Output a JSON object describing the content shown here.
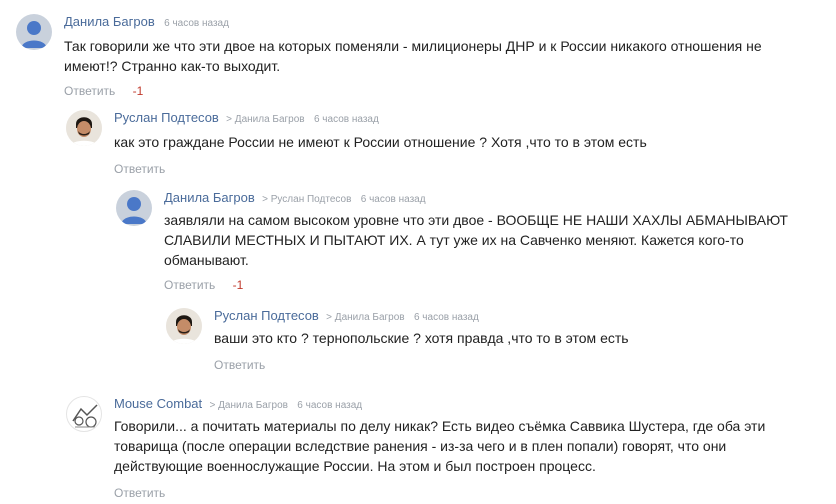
{
  "comments": [
    {
      "author": "Данила Багров",
      "reply_to": "",
      "time": "6 часов назад",
      "lines": [
        "Так говорили же что эти двое на которых поменяли - милиционеры ДНР и к России никакого отношения не",
        "имеют!? Странно как-то выходит."
      ],
      "reply_label": "Ответить",
      "vote": "-1",
      "avatar": "default-user-icon"
    },
    {
      "author": "Руслан Подтесов",
      "reply_to": "> Данила Багров",
      "time": "6 часов назад",
      "lines": [
        "как это граждане России не имеют к России отношение ? Хотя ,что то в этом есть"
      ],
      "reply_label": "Ответить",
      "vote": "",
      "avatar": "user-photo-icon"
    },
    {
      "author": "Данила Багров",
      "reply_to": "> Руслан Подтесов",
      "time": "6 часов назад",
      "lines": [
        "заявляли на самом высоком уровне что эти двое - ВООБЩЕ НЕ НАШИ ХАХЛЫ АБМАНЫВАЮТ",
        "СЛАВИЛИ МЕСТНЫХ И ПЫТАЮТ ИХ. А тут уже их на Савченко меняют. Кажется кого-то",
        "обманывают."
      ],
      "reply_label": "Ответить",
      "vote": "-1",
      "avatar": "default-user-icon"
    },
    {
      "author": "Руслан Подтесов",
      "reply_to": "> Данила Багров",
      "time": "6 часов назад",
      "lines": [
        "ваши это кто ? тернопольские ? хотя правда ,что то в этом есть"
      ],
      "reply_label": "Ответить",
      "vote": "",
      "avatar": "user-photo-icon"
    },
    {
      "author": "Mouse Combat",
      "reply_to": "> Данила Багров",
      "time": "6 часов назад",
      "lines": [
        "Говорили... а почитать материалы по делу никак? Есть видео съёмка Саввика Шустера, где оба эти",
        "товарища (после операции вследствие ранения - из-за чего и в плен попали) говорят, что они",
        "действующие военнослужащие России. На этом и был построен процесс."
      ],
      "reply_label": "Ответить",
      "vote": "",
      "avatar": "sketch-avatar-icon"
    }
  ]
}
